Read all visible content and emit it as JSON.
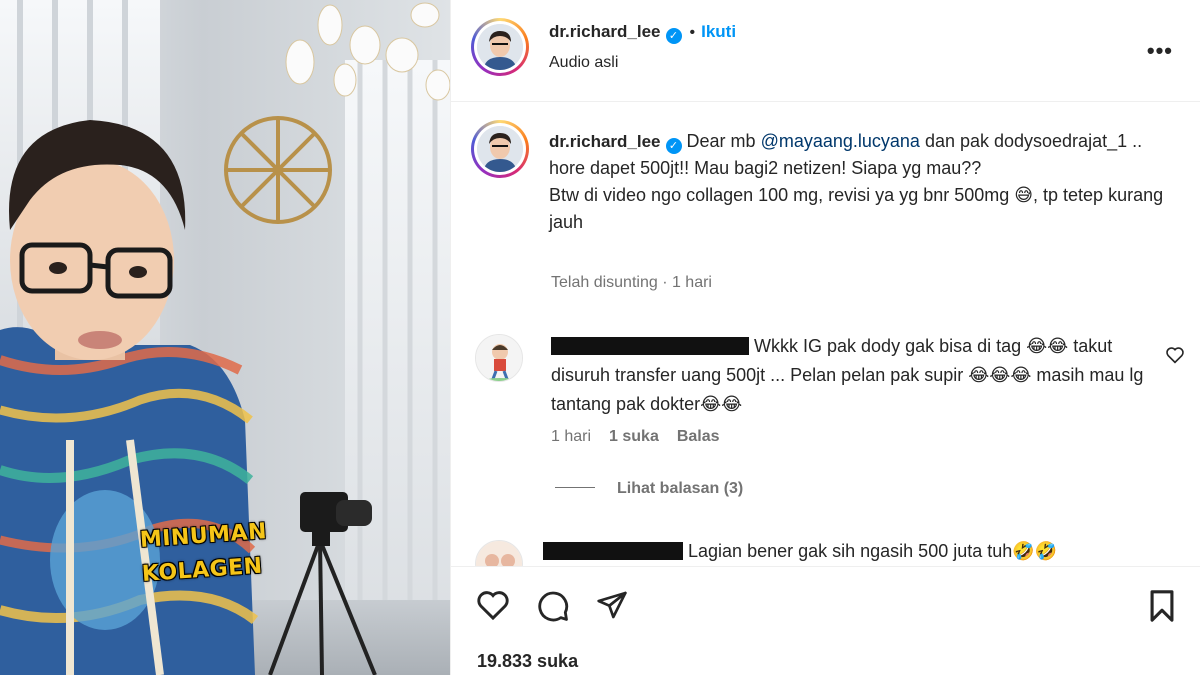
{
  "header": {
    "username": "dr.richard_lee",
    "follow_label": "Ikuti",
    "subtitle": "Audio asli",
    "more_label": "•••"
  },
  "video": {
    "overlay_line1": "MINUMAN",
    "overlay_line2": "KOLAGEN"
  },
  "caption": {
    "username": "dr.richard_lee",
    "text_before_mention": "Dear mb ",
    "mention": "@mayaang.lucyana",
    "text_after_mention": " dan pak dodysoedrajat_1 .. hore dapet 500jt!! Mau bagi2 netizen! Siapa yg mau??",
    "line2": "Btw di video ngo collagen 100 mg, revisi ya yg bnr 500mg 😅, tp tetep kurang jauh",
    "meta": "Telah disunting · 1 hari"
  },
  "comments": [
    {
      "text": "Wkkk IG pak dody gak bisa di tag 😂😂 takut disuruh transfer uang 500jt ... Pelan pelan pak supir 😂😂😂 masih mau lg tantang pak dokter😂😂",
      "time": "1 hari",
      "likes": "1 suka",
      "reply_label": "Balas",
      "view_replies": "Lihat balasan (3)"
    },
    {
      "text": "Lagian bener gak sih ngasih 500 juta tuh🤣🤣"
    }
  ],
  "actions": {
    "likes_count": "19.833 suka"
  },
  "colors": {
    "accent_blue": "#0095f6",
    "mention_blue": "#00376b",
    "muted_text": "#737373",
    "overlay_yellow": "#f5c518"
  }
}
